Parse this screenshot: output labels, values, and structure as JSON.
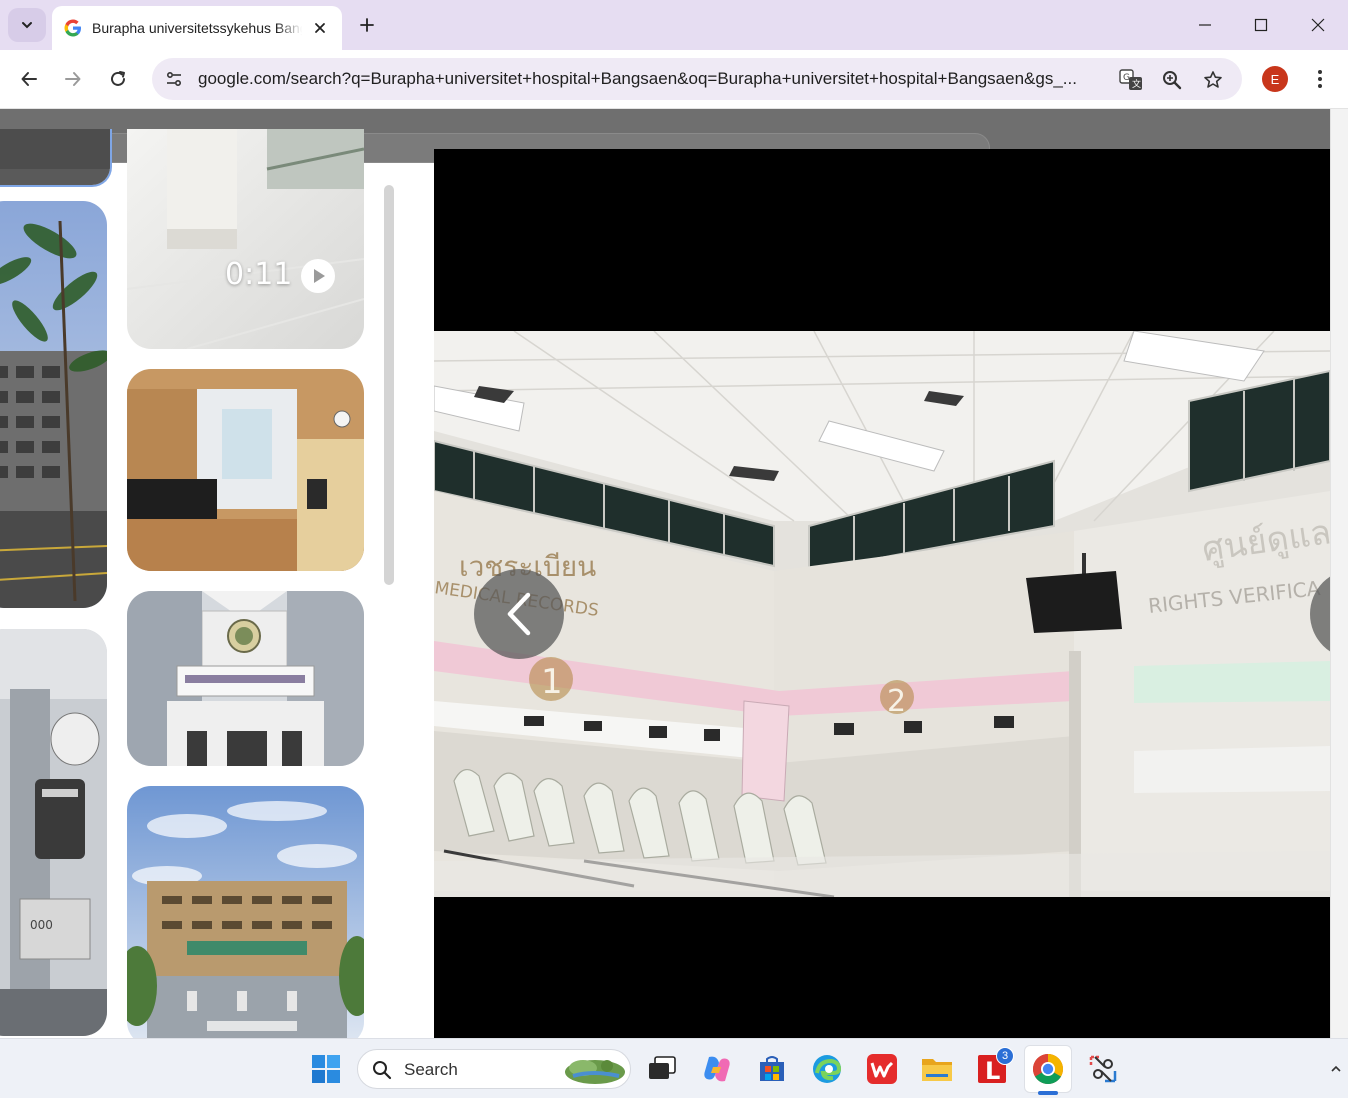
{
  "browser": {
    "tab": {
      "title": "Burapha universitetssykehus Bangsaen - Google Search"
    },
    "address": {
      "url": "google.com/search?q=Burapha+universitet+hospital+Bangsaen&oq=Burapha+universitet+hospital+Bangsaen&gs_..."
    },
    "profile": {
      "initial": "E"
    }
  },
  "content": {
    "video_thumb": {
      "duration": "0:11"
    },
    "viewer_photo": {
      "sign_left_thai": "เวชระเบียน",
      "sign_left_en": "MEDICAL RECORDS",
      "sign_right_thai": "ศูนย์ดูแล",
      "sign_right_en": "RIGHTS VERIFICA",
      "counter_1": "1",
      "counter_2": "2"
    }
  },
  "taskbar": {
    "search_label": "Search",
    "badge_count": "3"
  },
  "colors": {
    "titlebar": "#e6ddf2",
    "omnibox": "#efeaf5",
    "profile": "#c8361b",
    "taskbar": "#eef1f7",
    "accent": "#2b6fd6"
  }
}
